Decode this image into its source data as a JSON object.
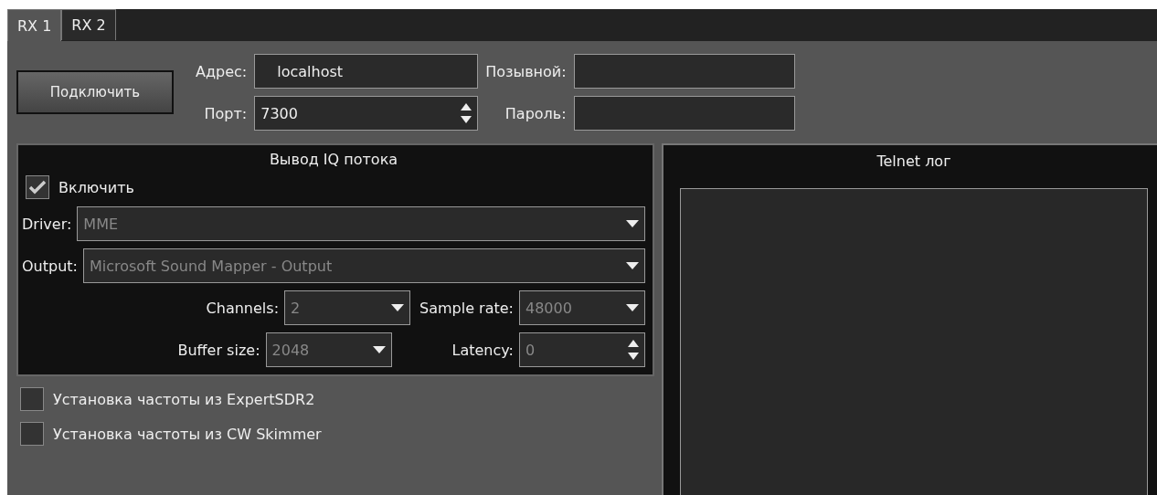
{
  "tabs": [
    {
      "label": "RX 1",
      "selected": true
    },
    {
      "label": "RX 2",
      "selected": false
    }
  ],
  "connect_button": "Подключить",
  "connection": {
    "address": {
      "label": "Адрес:",
      "value": "localhost"
    },
    "port": {
      "label": "Порт:",
      "value": "7300"
    },
    "callsign": {
      "label": "Позывной:"
    },
    "password": {
      "label": "Пароль:"
    }
  },
  "iq_output": {
    "title": "Вывод IQ потока",
    "enable": {
      "label": "Включить",
      "checked": true
    },
    "driver": {
      "label": "Driver:",
      "value": "MME"
    },
    "output": {
      "label": "Output:",
      "value": "Microsoft Sound Mapper - Output"
    },
    "channels": {
      "label": "Channels:",
      "value": "2"
    },
    "sample_rate": {
      "label": "Sample rate:",
      "value": "48000"
    },
    "buffer_size": {
      "label": "Buffer size:",
      "value": "2048"
    },
    "latency": {
      "label": "Latency:",
      "value": "0"
    }
  },
  "options": [
    {
      "label": "Установка частоты из ExpertSDR2",
      "checked": false
    },
    {
      "label": "Установка частоты из CW Skimmer",
      "checked": false
    }
  ],
  "telnet": {
    "title": "Telnet лог"
  }
}
